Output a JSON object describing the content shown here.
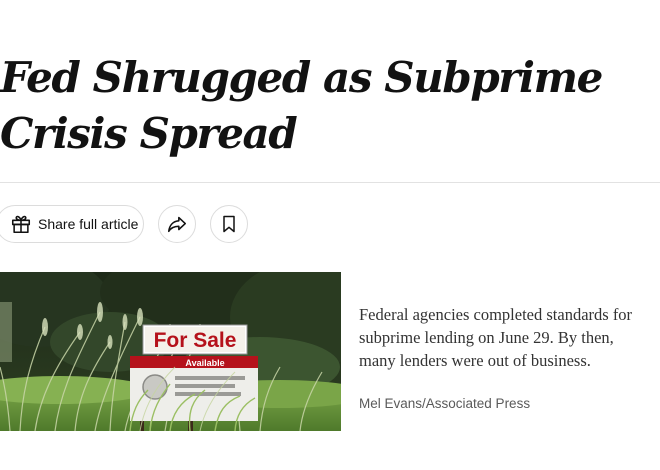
{
  "article": {
    "headline": "Fed Shrugged as Subprime Crisis Spread"
  },
  "share_bar": {
    "share_label": "Share full article",
    "share_icon": "gift-icon",
    "forward_icon": "share-arrow-icon",
    "bookmark_icon": "bookmark-icon"
  },
  "figure": {
    "sign_title": "For Sale",
    "sign_subtitle": "Available",
    "caption": "Federal agencies completed standards for subprime lending on June 29. By then, many lenders were out of business.",
    "credit": "Mel Evans/Associated Press"
  },
  "colors": {
    "text": "#121212",
    "sign_red": "#b5121b",
    "grass_green": "#6f9a3a"
  }
}
